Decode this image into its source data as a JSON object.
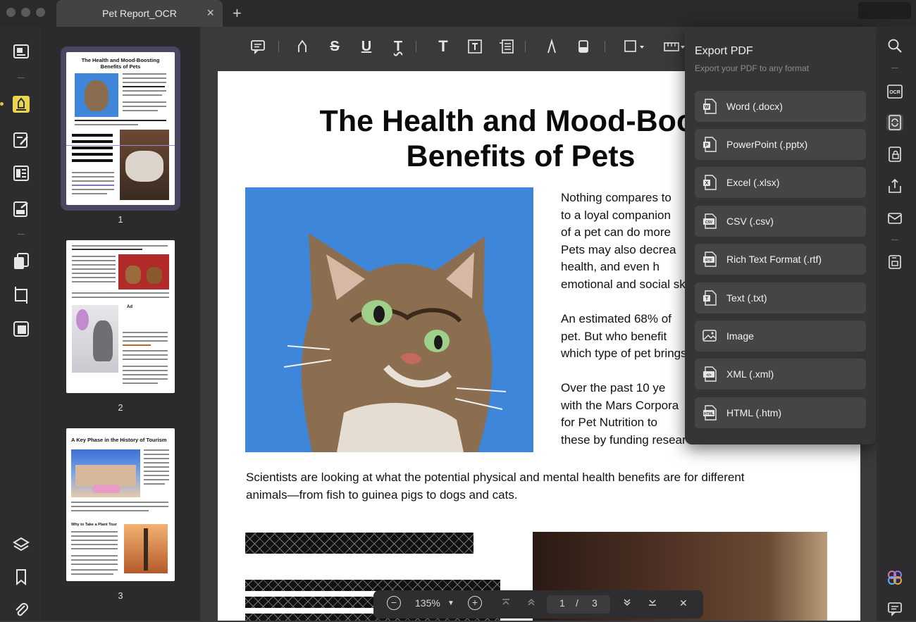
{
  "tab": {
    "title": "Pet Report_OCR",
    "close": "×",
    "new": "+"
  },
  "left_rail": {
    "items": [
      "reader-icon",
      "highlight-icon",
      "edit-icon",
      "form-icon",
      "fill-sign-icon",
      "organize-icon",
      "crop-icon",
      "compress-icon",
      "layers-icon",
      "bookmark-icon",
      "attachment-icon"
    ]
  },
  "thumbnails": {
    "pages": [
      {
        "number": "1",
        "heading": "The Health and Mood-Boosting Benefits of Pets"
      },
      {
        "number": "2",
        "heading": ""
      },
      {
        "number": "3",
        "heading": "A Key Phase in the History of Tourism",
        "subheading": "Why to Take a Plant Tour"
      }
    ]
  },
  "toolbar": {
    "tools": [
      "comment-icon",
      "highlighter-icon",
      "strikethrough-icon",
      "underline-icon",
      "squiggly-icon",
      "text-icon",
      "textbox-icon",
      "text-callout-icon",
      "pencil-icon",
      "eraser-icon",
      "shape-icon",
      "measure-icon"
    ]
  },
  "document": {
    "title_line1": "The Health and Mood-Boost",
    "title_line2": "Benefits of Pets",
    "para1": [
      "Nothing compares to",
      "to a loyal companion",
      "of a pet can do more",
      "Pets may also decrea",
      "health, and even h",
      "emotional and social sk"
    ],
    "para2": [
      "An estimated 68% of",
      "pet. But who benefit",
      "which type of pet brings"
    ],
    "para3": [
      "Over the past 10 ye",
      "with the Mars Corpora",
      "for Pet Nutrition to",
      "these by funding resear"
    ],
    "para4": "Scientists are looking at what the potential physical and mental health benefits are for different animals—from fish to guinea pigs to dogs and cats."
  },
  "zoom_bar": {
    "zoom_out": "−",
    "zoom_value": "135%",
    "zoom_in": "+",
    "current_page": "1",
    "separator": "/",
    "total_pages": "3",
    "close": "✕"
  },
  "export_panel": {
    "title": "Export PDF",
    "subtitle": "Export your PDF to any format",
    "options": [
      {
        "label": "Word (.docx)",
        "icon": "word-icon",
        "tag": "W"
      },
      {
        "label": "PowerPoint (.pptx)",
        "icon": "powerpoint-icon",
        "tag": "P"
      },
      {
        "label": "Excel (.xlsx)",
        "icon": "excel-icon",
        "tag": "X"
      },
      {
        "label": "CSV (.csv)",
        "icon": "csv-icon",
        "tag": "CSV"
      },
      {
        "label": "Rich Text Format (.rtf)",
        "icon": "rtf-icon",
        "tag": "RTF"
      },
      {
        "label": "Text (.txt)",
        "icon": "text-file-icon",
        "tag": "T"
      },
      {
        "label": "Image",
        "icon": "image-icon",
        "tag": ""
      },
      {
        "label": "XML (.xml)",
        "icon": "xml-icon",
        "tag": "</>"
      },
      {
        "label": "HTML (.htm)",
        "icon": "html-icon",
        "tag": "HTML"
      }
    ]
  },
  "right_rail": {
    "items": [
      "search-icon",
      "ocr-icon",
      "convert-icon",
      "protect-icon",
      "share-icon",
      "email-icon",
      "save-icon",
      "ai-assistant-icon",
      "comments-icon"
    ],
    "ocr_label": "OCR"
  }
}
